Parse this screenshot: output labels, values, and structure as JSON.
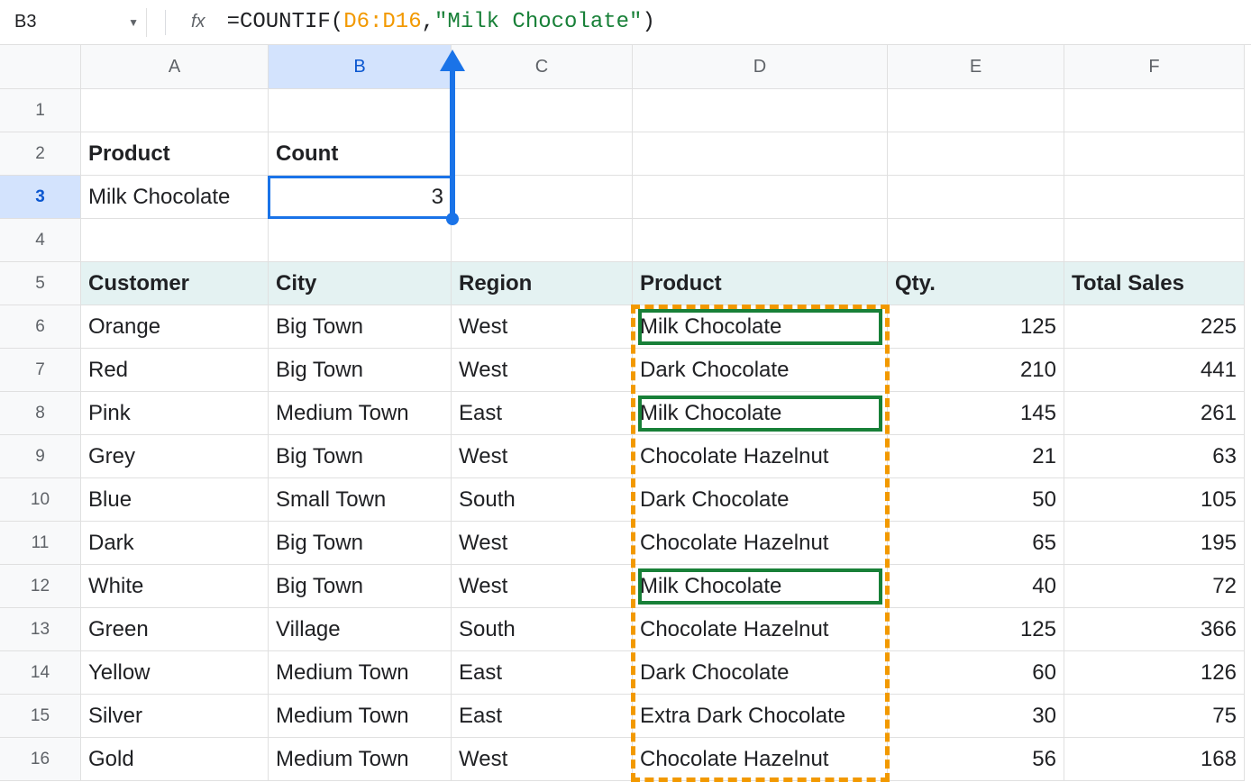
{
  "nameBox": "B3",
  "formula": {
    "prefix": "=COUNTIF(",
    "range": "D6:D16",
    "sep": ",",
    "arg": "\"Milk Chocolate\"",
    "suffix": ")"
  },
  "columns": [
    "A",
    "B",
    "C",
    "D",
    "E",
    "F"
  ],
  "rows": [
    "1",
    "2",
    "3",
    "4",
    "5",
    "6",
    "7",
    "8",
    "9",
    "10",
    "11",
    "12",
    "13",
    "14",
    "15",
    "16"
  ],
  "selectedCol": "B",
  "selectedRow": "3",
  "top": {
    "r2": {
      "A": "Product",
      "B": "Count"
    },
    "r3": {
      "A": "Milk Chocolate",
      "B": "3"
    }
  },
  "tableHeader": {
    "A": "Customer",
    "B": "City",
    "C": "Region",
    "D": "Product",
    "E": "Qty.",
    "F": "Total Sales"
  },
  "table": [
    {
      "A": "Orange",
      "B": "Big Town",
      "C": "West",
      "D": "Milk Chocolate",
      "E": "125",
      "F": "225"
    },
    {
      "A": "Red",
      "B": "Big Town",
      "C": "West",
      "D": "Dark Chocolate",
      "E": "210",
      "F": "441"
    },
    {
      "A": "Pink",
      "B": "Medium Town",
      "C": "East",
      "D": "Milk Chocolate",
      "E": "145",
      "F": "261"
    },
    {
      "A": "Grey",
      "B": "Big Town",
      "C": "West",
      "D": "Chocolate Hazelnut",
      "E": "21",
      "F": "63"
    },
    {
      "A": "Blue",
      "B": "Small Town",
      "C": "South",
      "D": "Dark Chocolate",
      "E": "50",
      "F": "105"
    },
    {
      "A": "Dark",
      "B": "Big Town",
      "C": "West",
      "D": "Chocolate Hazelnut",
      "E": "65",
      "F": "195"
    },
    {
      "A": "White",
      "B": "Big Town",
      "C": "West",
      "D": "Milk Chocolate",
      "E": "40",
      "F": "72"
    },
    {
      "A": "Green",
      "B": "Village",
      "C": "South",
      "D": "Chocolate Hazelnut",
      "E": "125",
      "F": "366"
    },
    {
      "A": "Yellow",
      "B": "Medium Town",
      "C": "East",
      "D": "Dark Chocolate",
      "E": "60",
      "F": "126"
    },
    {
      "A": "Silver",
      "B": "Medium Town",
      "C": "East",
      "D": "Extra Dark Chocolate",
      "E": "30",
      "F": "75"
    },
    {
      "A": "Gold",
      "B": "Medium Town",
      "C": "West",
      "D": "Chocolate Hazelnut",
      "E": "56",
      "F": "168"
    }
  ]
}
